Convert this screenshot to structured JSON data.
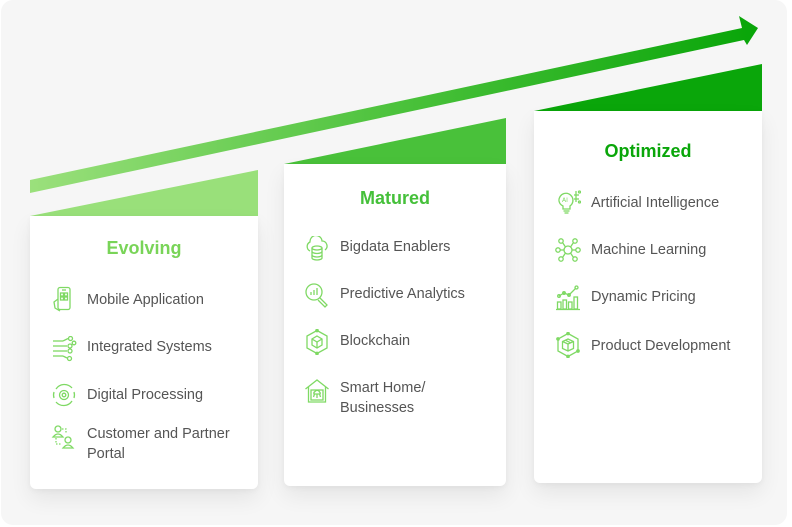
{
  "colors": {
    "stage1": "#99e07a",
    "stage2": "#49c13a",
    "stage3": "#0aa60a",
    "title1": "#79d458",
    "title2": "#45c03a",
    "title3": "#0aa60a",
    "icon": "#7fd964",
    "text": "#555555",
    "background": "#f6f6f6"
  },
  "arrow": {
    "direction": "up-right",
    "meaning": "growth"
  },
  "stages": [
    {
      "title": "Evolving",
      "items": [
        {
          "label": "Mobile Application",
          "icon": "mobile-app-icon"
        },
        {
          "label": "Integrated Systems",
          "icon": "integrated-systems-icon"
        },
        {
          "label": "Digital Processing",
          "icon": "digital-processing-icon"
        },
        {
          "label": "Customer and Partner Portal",
          "icon": "customer-portal-icon"
        }
      ]
    },
    {
      "title": "Matured",
      "items": [
        {
          "label": "Bigdata Enablers",
          "icon": "bigdata-icon"
        },
        {
          "label": "Predictive Analytics",
          "icon": "predictive-analytics-icon"
        },
        {
          "label": "Blockchain",
          "icon": "blockchain-icon"
        },
        {
          "label": "Smart Home/ Businesses",
          "icon": "smart-home-icon"
        }
      ]
    },
    {
      "title": "Optimized",
      "items": [
        {
          "label": "Artificial Intelligence",
          "icon": "ai-icon"
        },
        {
          "label": "Machine Learning",
          "icon": "machine-learning-icon"
        },
        {
          "label": "Dynamic Pricing",
          "icon": "dynamic-pricing-icon"
        },
        {
          "label": "Product Development",
          "icon": "product-development-icon"
        }
      ]
    }
  ]
}
